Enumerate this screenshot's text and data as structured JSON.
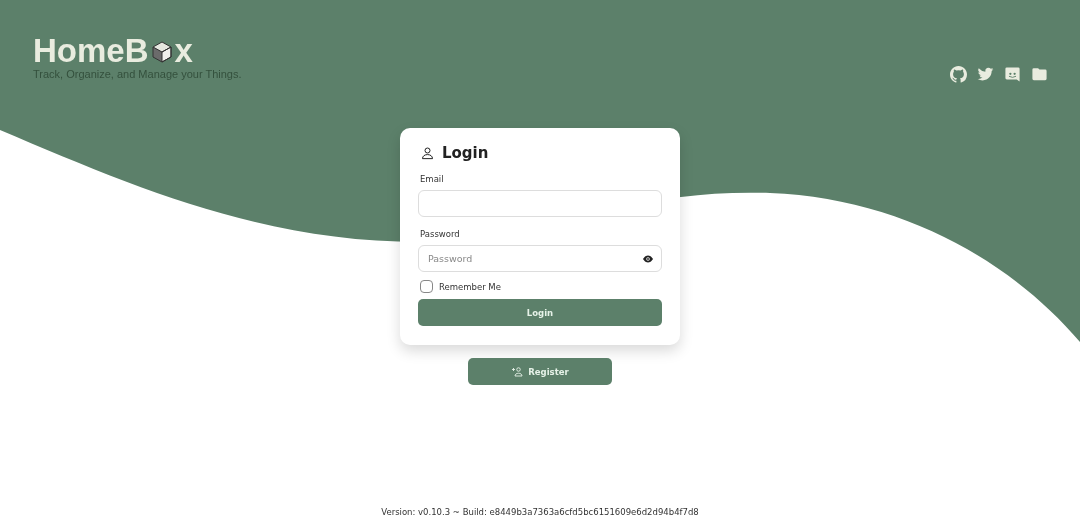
{
  "header": {
    "logo_start": "HomeB",
    "logo_end": "x",
    "tagline": "Track, Organize, and Manage your Things."
  },
  "login_card": {
    "title": "Login",
    "email": {
      "label": "Email"
    },
    "password": {
      "label": "Password",
      "placeholder": "Password"
    },
    "remember_me": {
      "label": "Remember Me",
      "checked": false
    },
    "submit": "Login"
  },
  "register_button": "Register",
  "footer": "Version: v0.10.3 ~ Build: e8449b3a7363a6cfd5bc6151609e6d2d94b4f7d8"
}
